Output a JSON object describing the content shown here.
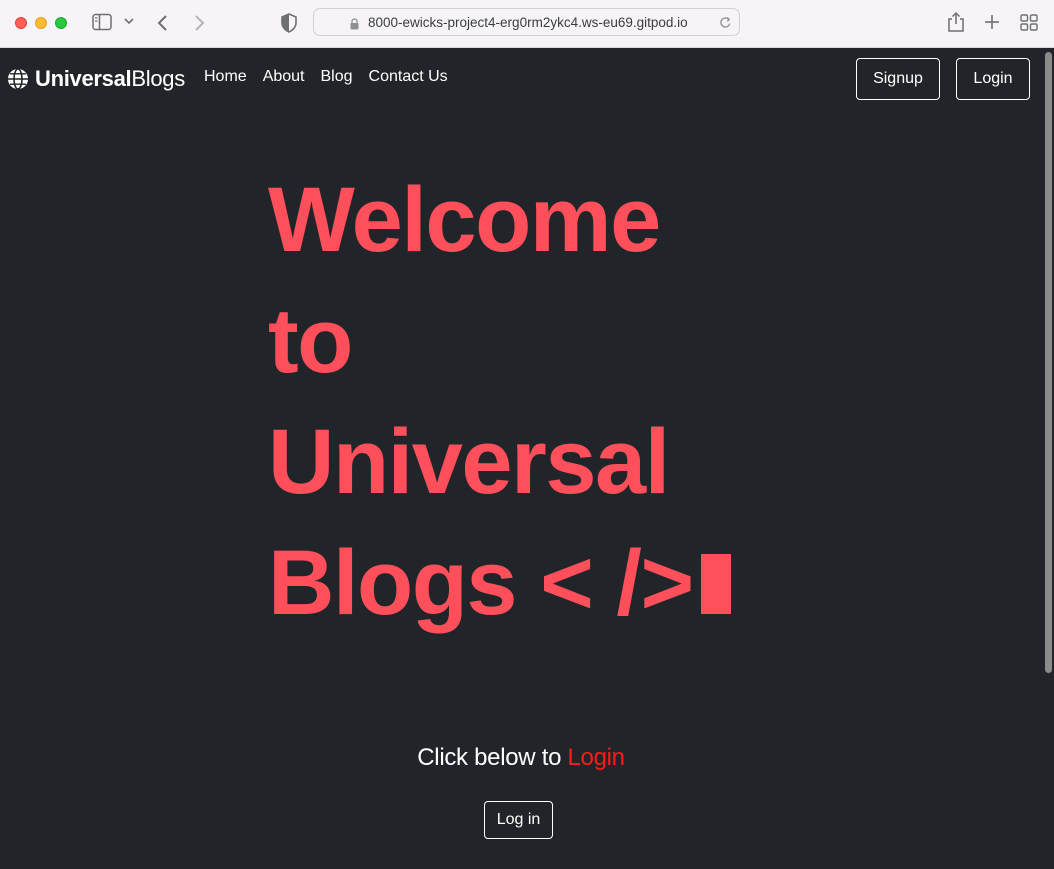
{
  "browser": {
    "url": "8000-ewicks-project4-erg0rm2ykc4.ws-eu69.gitpod.io"
  },
  "navbar": {
    "brand_bold": "Universal",
    "brand_light": "Blogs",
    "links": [
      "Home",
      "About",
      "Blog",
      "Contact Us"
    ],
    "signup_label": "Signup",
    "login_label": "Login"
  },
  "hero": {
    "lines": [
      "Welcome",
      "to",
      "Universal",
      "Blogs < />"
    ]
  },
  "cta": {
    "text": "Click below to",
    "accent": "Login",
    "button_label": "Log in"
  },
  "colors": {
    "background": "#212529",
    "hero_text": "#ff4f5a",
    "cta_accent": "#ff1a1a"
  }
}
